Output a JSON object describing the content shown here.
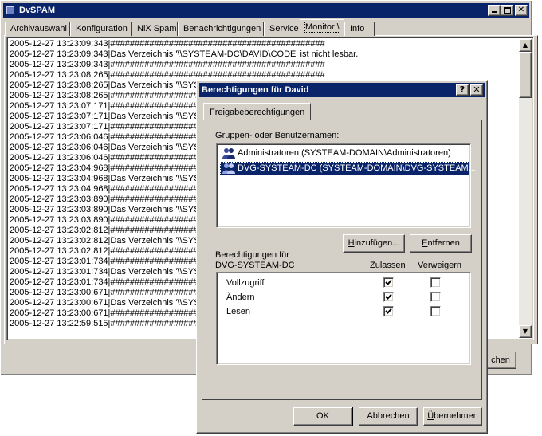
{
  "main_window": {
    "title": "DvSPAM",
    "tabs": [
      {
        "label": "Archivauswahl"
      },
      {
        "label": "Konfiguration"
      },
      {
        "label": "NiX Spam"
      },
      {
        "label": "Benachrichtigungen"
      },
      {
        "label": "Service"
      },
      {
        "label": "Monitor \\"
      },
      {
        "label": "Info"
      }
    ],
    "active_tab": "Monitor \\",
    "log_lines": [
      "2005-12-27 13:23:09:343|############################################",
      "2005-12-27 13:23:09:343|Das Verzeichnis '\\\\SYSTEAM-DC\\DAVID\\CODE' ist nicht lesbar.",
      "2005-12-27 13:23:09:343|############################################",
      "2005-12-27 13:23:08:265|############################################",
      "2005-12-27 13:23:08:265|Das Verzeichnis '\\\\SYS",
      "2005-12-27 13:23:08:265|#####################",
      "2005-12-27 13:23:07:171|#####################",
      "2005-12-27 13:23:07:171|Das Verzeichnis '\\\\SYS",
      "2005-12-27 13:23:07:171|#####################",
      "2005-12-27 13:23:06:046|#####################",
      "2005-12-27 13:23:06:046|Das Verzeichnis '\\\\SYS",
      "2005-12-27 13:23:06:046|#####################",
      "2005-12-27 13:23:04:968|#####################",
      "2005-12-27 13:23:04:968|Das Verzeichnis '\\\\SYS",
      "2005-12-27 13:23:04:968|#####################",
      "2005-12-27 13:23:03:890|#####################",
      "2005-12-27 13:23:03:890|Das Verzeichnis '\\\\SYS",
      "2005-12-27 13:23:03:890|#####################",
      "2005-12-27 13:23:02:812|#####################",
      "2005-12-27 13:23:02:812|Das Verzeichnis '\\\\SYS",
      "2005-12-27 13:23:02:812|#####################",
      "2005-12-27 13:23:01:734|#####################",
      "2005-12-27 13:23:01:734|Das Verzeichnis '\\\\SYS",
      "2005-12-27 13:23:01:734|#####################",
      "2005-12-27 13:23:00:671|#####################",
      "2005-12-27 13:23:00:671|Das Verzeichnis '\\\\SYS",
      "2005-12-27 13:23:00:671|#####################",
      "2005-12-27 13:22:59:515|#####################"
    ],
    "bottom_button": "chen"
  },
  "dialog": {
    "title": "Berechtigungen für David",
    "help_button": "?",
    "close_button": "✕",
    "tab": "Freigabeberechtigungen",
    "groups_label_u": "G",
    "groups_label_rest": "ruppen- oder Benutzernamen:",
    "users": [
      {
        "name": "Administratoren (SYSTEAM-DOMAIN\\Administratoren)",
        "selected": false
      },
      {
        "name": "DVG-SYSTEAM-DC (SYSTEAM-DOMAIN\\DVG-SYSTEAM...",
        "selected": true
      }
    ],
    "add_button_u": "H",
    "add_button_rest": "inzufügen...",
    "remove_button_u": "E",
    "remove_button_rest": "ntfernen",
    "permissions_label_1": "Berechtigungen für",
    "permissions_label_2": "DVG-SYSTEAM-DC",
    "col_allow": "Zulassen",
    "col_deny": "Verweigern",
    "permissions": [
      {
        "name": "Vollzugriff",
        "allow": true,
        "deny": false
      },
      {
        "name": "Ändern",
        "allow": true,
        "deny": false
      },
      {
        "name": "Lesen",
        "allow": true,
        "deny": false
      }
    ],
    "ok_button": "OK",
    "cancel_button": "Abbrechen",
    "apply_button_u": "Ü",
    "apply_button_rest": "bernehmen"
  },
  "colors": {
    "titlebar": "#0a246a",
    "selection": "#0a246a",
    "face": "#d4d0c8"
  }
}
